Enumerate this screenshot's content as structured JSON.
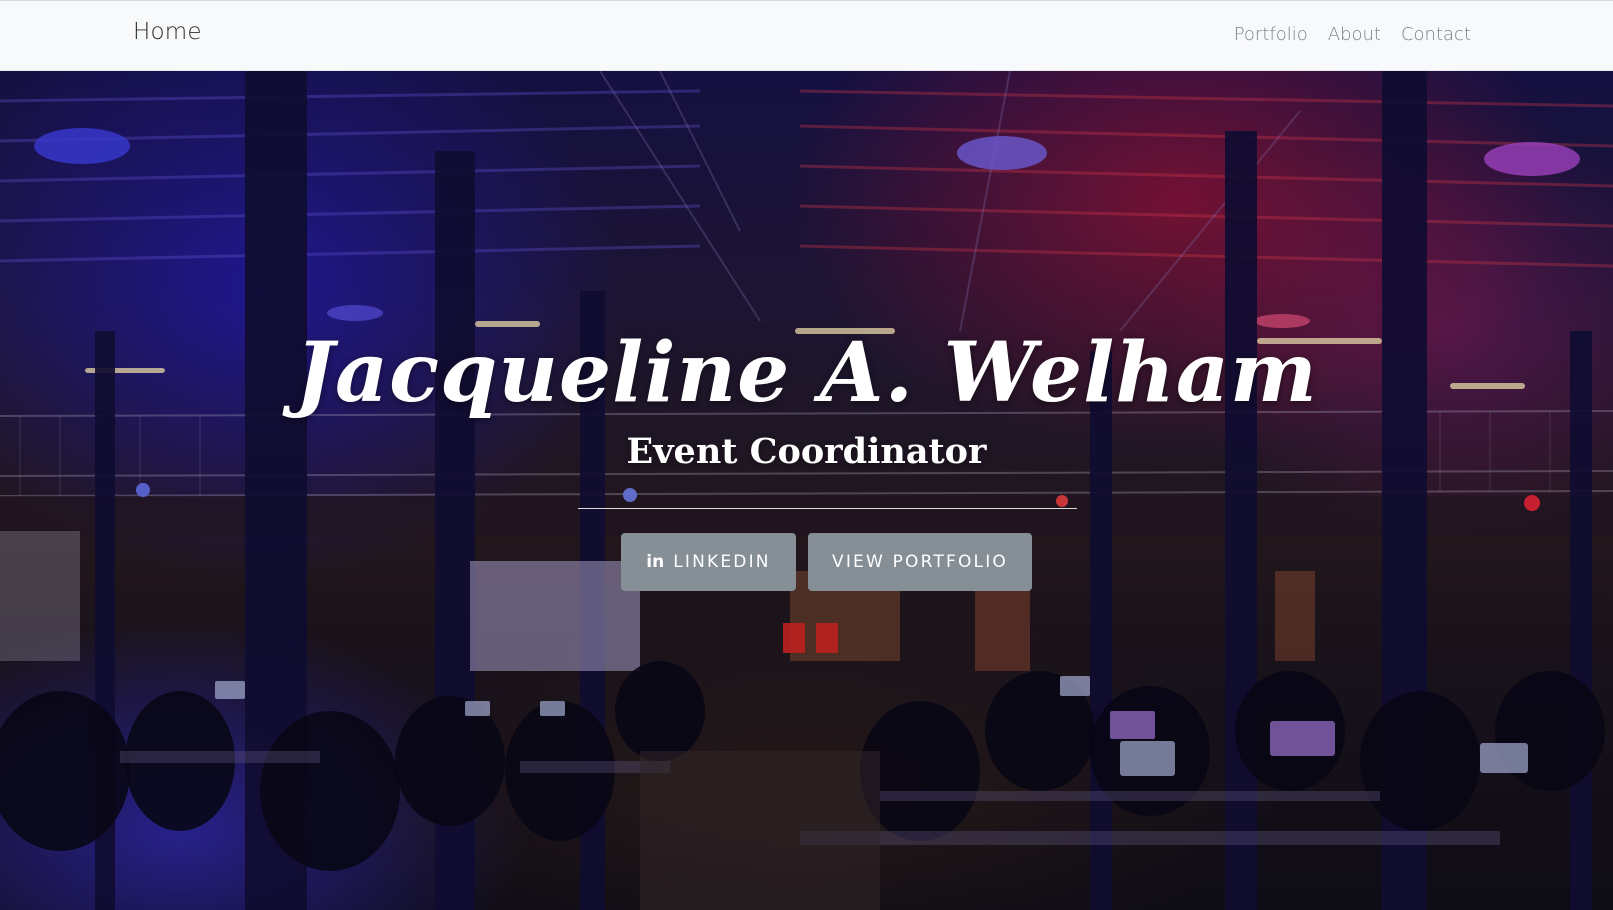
{
  "navbar": {
    "brand": "Home",
    "links": [
      "Portfolio",
      "About",
      "Contact"
    ]
  },
  "hero": {
    "title": "Jacqueline A. Welham",
    "subtitle": "Event Coordinator",
    "buttons": {
      "linkedin_icon": "in",
      "linkedin_label": "LINKEDIN",
      "portfolio_label": "VIEW PORTFOLIO"
    },
    "background_image": "dimly lit hackathon hall with blue and red stage lighting, rows of attendees at laptops"
  },
  "colors": {
    "navbar_bg": "#f8f9fa",
    "nav_link": "#7b7f83",
    "brand_text": "#2b2b2b",
    "button_bg": "#868e96",
    "hero_text": "#ffffff"
  }
}
